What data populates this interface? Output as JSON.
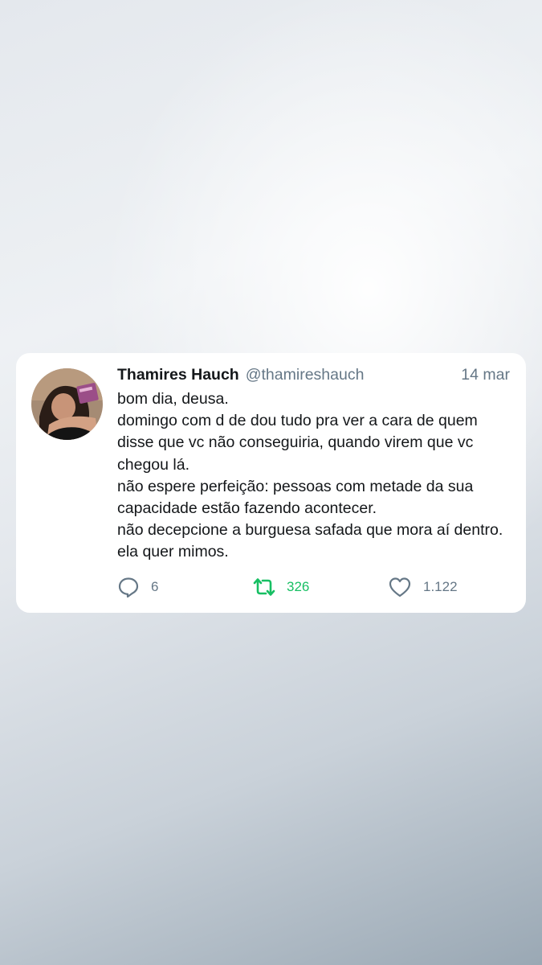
{
  "tweet": {
    "author_name": "Thamires Hauch",
    "author_handle": "@thamireshauch",
    "date": "14 mar",
    "lines": [
      "bom dia, deusa.",
      "domingo com d de dou tudo pra ver a cara de quem",
      "disse que vc não conseguiria, quando virem que vc",
      "chegou lá.",
      "não espere perfeição: pessoas com metade da sua",
      "capacidade estão fazendo acontecer.",
      "não decepcione a burguesa safada que mora aí dentro.",
      "ela quer mimos."
    ],
    "actions": {
      "reply_count": "6",
      "retweet_count": "326",
      "like_count": "1.122"
    }
  },
  "icons": {
    "reply": "reply-bubble-icon",
    "retweet": "retweet-icon",
    "like": "heart-icon"
  },
  "colors": {
    "retweet_active": "#17bf63",
    "secondary_text": "#657786",
    "primary_text": "#14171a",
    "card_background": "#ffffff"
  }
}
